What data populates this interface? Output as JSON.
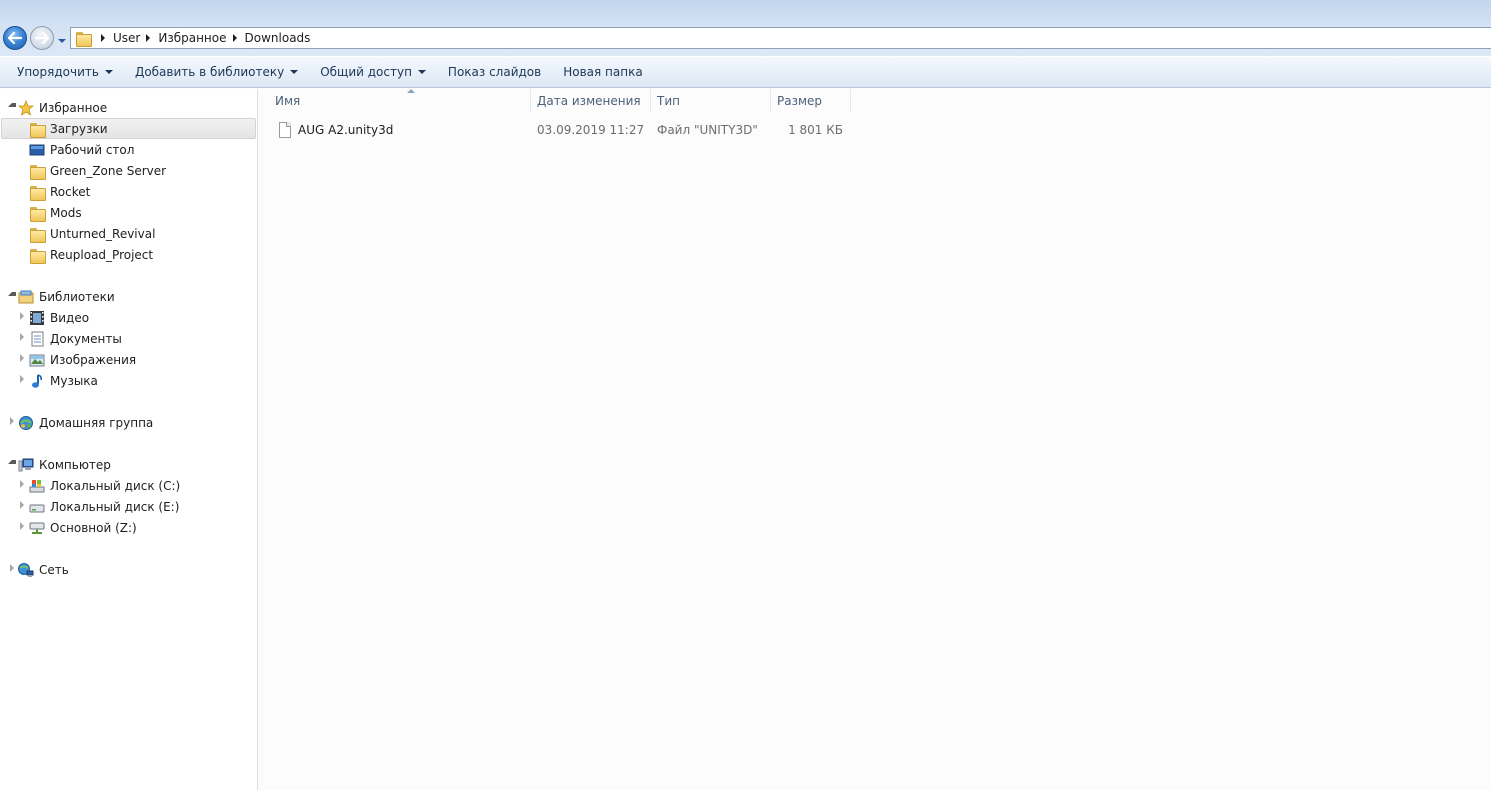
{
  "address": {
    "crumbs": [
      "User",
      "Избранное",
      "Downloads"
    ]
  },
  "commands": [
    {
      "label": "Упорядочить",
      "dropdown": true
    },
    {
      "label": "Добавить в библиотеку",
      "dropdown": true
    },
    {
      "label": "Общий доступ",
      "dropdown": true
    },
    {
      "label": "Показ слайдов",
      "dropdown": false
    },
    {
      "label": "Новая папка",
      "dropdown": false
    }
  ],
  "nav": {
    "favorites": {
      "label": "Избранное",
      "items": [
        "Загрузки",
        "Рабочий стол",
        "Green_Zone Server",
        "Rocket",
        "Mods",
        "Unturned_Revival",
        "Reupload_Project"
      ],
      "selected": "Загрузки"
    },
    "libraries": {
      "label": "Библиотеки",
      "items": [
        "Видео",
        "Документы",
        "Изображения",
        "Музыка"
      ]
    },
    "homegroup": {
      "label": "Домашняя группа"
    },
    "computer": {
      "label": "Компьютер",
      "items": [
        "Локальный диск (C:)",
        "Локальный диск (E:)",
        "Основной (Z:)"
      ]
    },
    "network": {
      "label": "Сеть"
    }
  },
  "columns": {
    "name": "Имя",
    "date": "Дата изменения",
    "type": "Тип",
    "size": "Размер"
  },
  "files": [
    {
      "name": "AUG A2.unity3d",
      "date": "03.09.2019 11:27",
      "type": "Файл \"UNITY3D\"",
      "size": "1 801 КБ"
    }
  ],
  "colors": {
    "selection": "#e8e8e8",
    "command_text": "#1e3658",
    "header_text": "#4c607a"
  }
}
